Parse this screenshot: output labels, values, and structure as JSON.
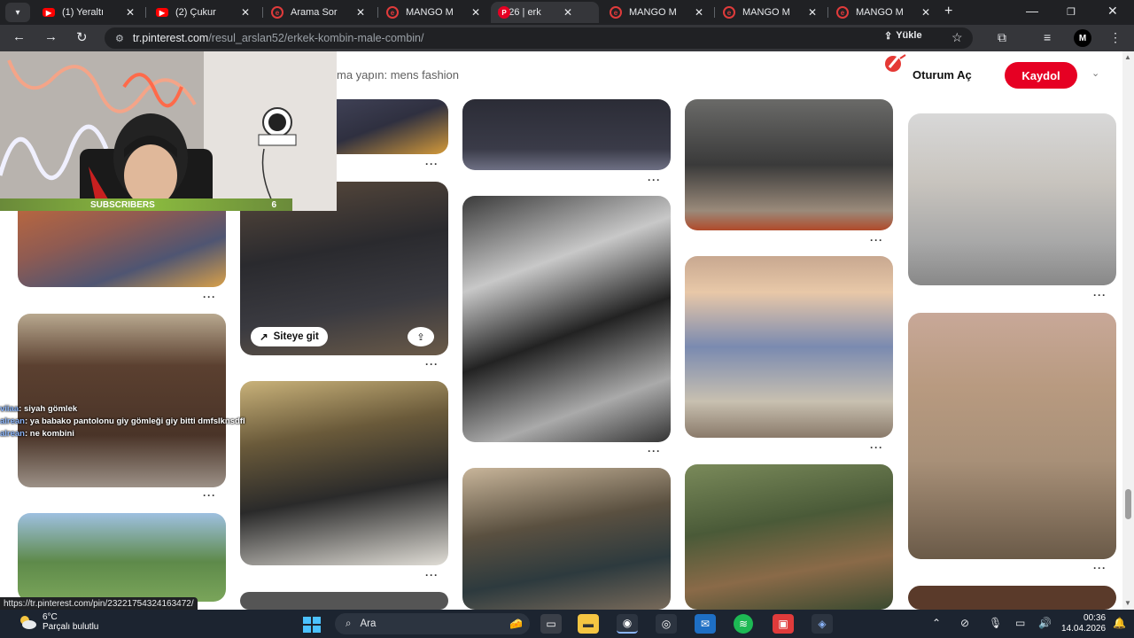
{
  "tabs": [
    {
      "title": "(1) Yeraltı",
      "icon": "youtube-icon",
      "active": false
    },
    {
      "title": "(2) Çukur",
      "icon": "youtube-icon",
      "active": false
    },
    {
      "title": "Arama Sor",
      "icon": "mango-icon",
      "active": false
    },
    {
      "title": "MANGO M",
      "icon": "mango-icon",
      "active": false
    },
    {
      "title": "2026 | erk",
      "icon": "pinterest-icon",
      "active": true
    },
    {
      "title": "MANGO M",
      "icon": "mango-icon",
      "active": false
    },
    {
      "title": "MANGO M",
      "icon": "mango-icon",
      "active": false
    },
    {
      "title": "MANGO M",
      "icon": "mango-icon",
      "active": false
    }
  ],
  "address": {
    "host": "tr.pinterest.com",
    "path": "/resul_arslan52/erkek-kombin-male-combin/"
  },
  "toolbar": {
    "save_label": "Yükle",
    "profile_initial": "M"
  },
  "page": {
    "search_hint": "ma yapın: mens fashion",
    "login_label": "Oturum Aç",
    "signup_label": "Kaydol",
    "pin_visit_label": "Siteye git",
    "more_dots": "···"
  },
  "overlay": {
    "subscribers_label": "SUBSCRIBERS",
    "subscribers_count": "6",
    "chat": [
      {
        "user": "viiaa",
        "text": ": siyah gömlek"
      },
      {
        "user": "alrean",
        "text": ": ya babako pantolonu giy gömleği giy bitti dmfslknsdfl"
      },
      {
        "user": "alrean",
        "text": ": ne kombini"
      }
    ]
  },
  "status_url": "https://tr.pinterest.com/pin/23221754324163472/",
  "taskbar": {
    "temperature": "6°C",
    "weather": "Parçalı bulutlu",
    "search_label": "Ara",
    "time": "00:36",
    "date": "14.04.2026"
  },
  "colors": {
    "pinterest_red": "#e60023",
    "chrome_dark": "#202124",
    "toolbar_dark": "#35363a",
    "subscriber_green": "#8bbb3f"
  }
}
